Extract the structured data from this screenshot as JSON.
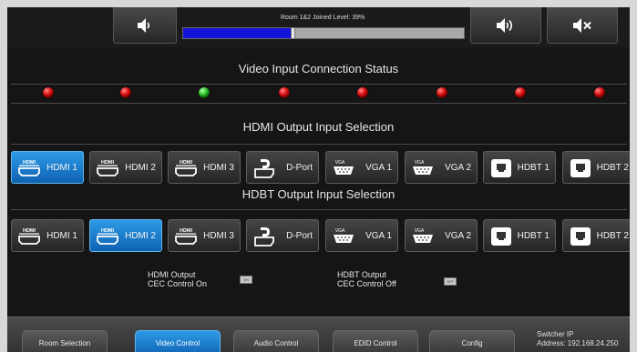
{
  "top": {
    "level_label": "Room 1&2 Joined Level: 39%",
    "level_value": 0.39,
    "buttons": [
      {
        "name": "volume-down-button",
        "icon": "speaker-low-icon"
      },
      {
        "name": "volume-up-button",
        "icon": "speaker-high-icon"
      },
      {
        "name": "mute-button",
        "icon": "speaker-mute-icon"
      }
    ]
  },
  "status": {
    "title": "Video Input Connection Status",
    "leds": [
      "red",
      "red",
      "green",
      "red",
      "red",
      "red",
      "red",
      "red"
    ]
  },
  "hdmi_output": {
    "title": "HDMI Output Input Selection",
    "selected": "HDMI 1",
    "sources": [
      {
        "label": "HDMI 1",
        "icon": "hdmi-icon"
      },
      {
        "label": "HDMI 2",
        "icon": "hdmi-icon"
      },
      {
        "label": "HDMI 3",
        "icon": "hdmi-icon"
      },
      {
        "label": "D-Port",
        "icon": "displayport-icon"
      },
      {
        "label": "VGA 1",
        "icon": "vga-icon"
      },
      {
        "label": "VGA 2",
        "icon": "vga-icon"
      },
      {
        "label": "HDBT 1",
        "icon": "ethernet-icon"
      },
      {
        "label": "HDBT 2",
        "icon": "ethernet-icon"
      }
    ]
  },
  "hdbt_output": {
    "title": "HDBT Output Input Selection",
    "selected": "HDMI 2",
    "sources": [
      {
        "label": "HDMI 1",
        "icon": "hdmi-icon"
      },
      {
        "label": "HDMI 2",
        "icon": "hdmi-icon"
      },
      {
        "label": "HDMI 3",
        "icon": "hdmi-icon"
      },
      {
        "label": "D-Port",
        "icon": "displayport-icon"
      },
      {
        "label": "VGA 1",
        "icon": "vga-icon"
      },
      {
        "label": "VGA 2",
        "icon": "vga-icon"
      },
      {
        "label": "HDBT 1",
        "icon": "ethernet-icon"
      },
      {
        "label": "HDBT 2",
        "icon": "ethernet-icon"
      }
    ]
  },
  "cec": {
    "hdmi_label_1": "HDMI Output",
    "hdmi_label_2": "CEC Control On",
    "hdmi_toggle": "ON",
    "hdbt_label_1": "HDBT Output",
    "hdbt_label_2": "CEC Control Off",
    "hdbt_toggle": "OFF"
  },
  "nav": {
    "items": [
      "Room Selection",
      "Video Control",
      "Audio Control",
      "EDID Control",
      "Config"
    ],
    "active": "Video Control",
    "ip_line1": "Switcher IP",
    "ip_line2": "Address: 192.168.24.250"
  },
  "colors": {
    "accent": "#1a7fd0",
    "level_fill": "#1212d8",
    "led_red": "#e01010",
    "led_green": "#2fc82a"
  },
  "icons": {
    "hdmi_text": "HDMI",
    "vga_text": "VGA"
  }
}
